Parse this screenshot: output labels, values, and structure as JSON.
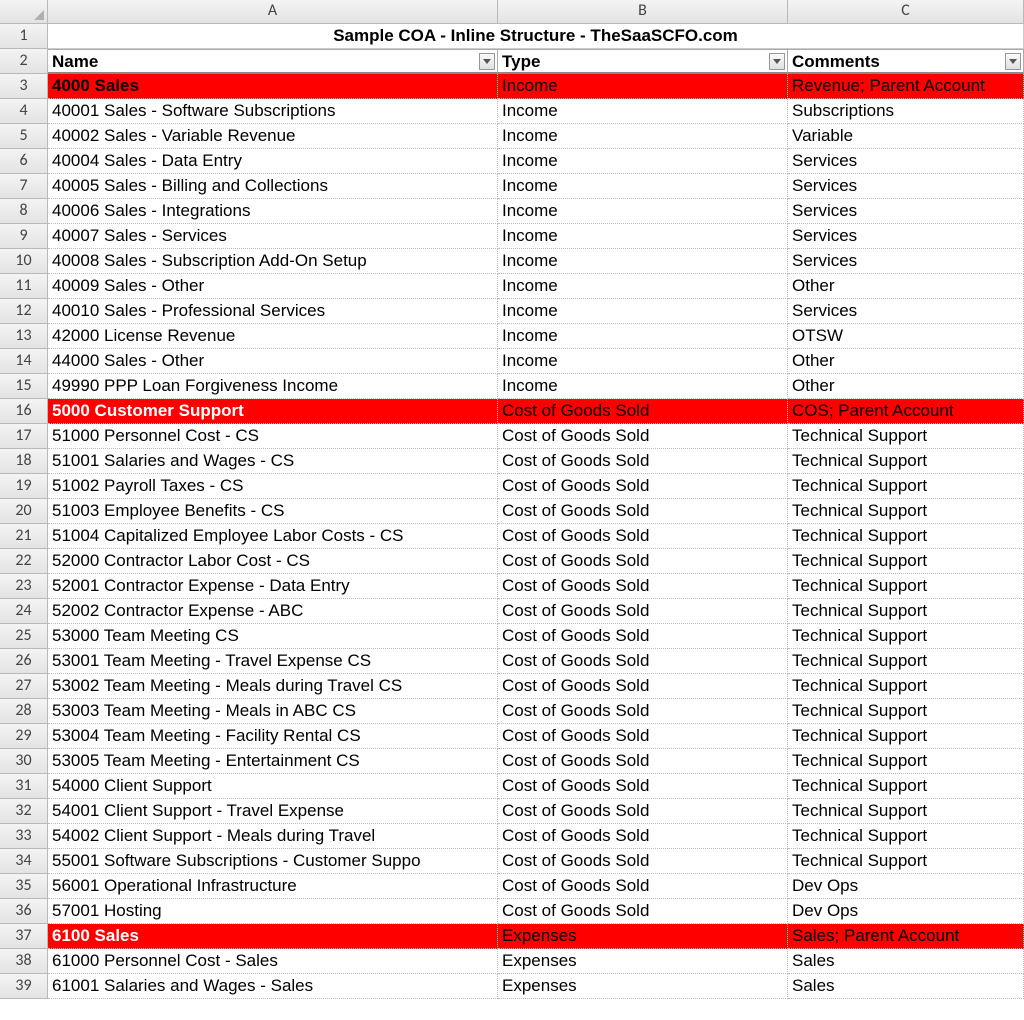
{
  "title": "Sample COA - Inline Structure - TheSaaSCFO.com",
  "columns": [
    "A",
    "B",
    "C"
  ],
  "headers": {
    "name": "Name",
    "type": "Type",
    "comments": "Comments"
  },
  "rows": [
    {
      "n": 3,
      "name": "4000 Sales",
      "type": "Income",
      "comments": "Revenue; Parent Account",
      "style": "parent-black"
    },
    {
      "n": 4,
      "name": "40001 Sales - Software Subscriptions",
      "type": "Income",
      "comments": "Subscriptions"
    },
    {
      "n": 5,
      "name": "40002 Sales - Variable Revenue",
      "type": "Income",
      "comments": "Variable"
    },
    {
      "n": 6,
      "name": "40004 Sales - Data Entry",
      "type": "Income",
      "comments": "Services"
    },
    {
      "n": 7,
      "name": "40005 Sales - Billing and Collections",
      "type": "Income",
      "comments": "Services"
    },
    {
      "n": 8,
      "name": "40006 Sales - Integrations",
      "type": "Income",
      "comments": "Services"
    },
    {
      "n": 9,
      "name": "40007 Sales - Services",
      "type": "Income",
      "comments": "Services"
    },
    {
      "n": 10,
      "name": "40008 Sales - Subscription Add-On Setup",
      "type": "Income",
      "comments": "Services"
    },
    {
      "n": 11,
      "name": "40009 Sales - Other",
      "type": "Income",
      "comments": "Other"
    },
    {
      "n": 12,
      "name": "40010 Sales - Professional Services",
      "type": "Income",
      "comments": "Services"
    },
    {
      "n": 13,
      "name": "42000 License Revenue",
      "type": "Income",
      "comments": "OTSW"
    },
    {
      "n": 14,
      "name": "44000 Sales - Other",
      "type": "Income",
      "comments": "Other"
    },
    {
      "n": 15,
      "name": "49990 PPP Loan Forgiveness Income",
      "type": "Income",
      "comments": "Other"
    },
    {
      "n": 16,
      "name": "5000 Customer Support",
      "type": "Cost of Goods Sold",
      "comments": "COS; Parent Account",
      "style": "parent-white"
    },
    {
      "n": 17,
      "name": "51000 Personnel Cost - CS",
      "type": "Cost of Goods Sold",
      "comments": "Technical Support"
    },
    {
      "n": 18,
      "name": "51001 Salaries and Wages - CS",
      "type": "Cost of Goods Sold",
      "comments": "Technical Support"
    },
    {
      "n": 19,
      "name": "51002 Payroll Taxes - CS",
      "type": "Cost of Goods Sold",
      "comments": "Technical Support"
    },
    {
      "n": 20,
      "name": "51003 Employee Benefits - CS",
      "type": "Cost of Goods Sold",
      "comments": "Technical Support"
    },
    {
      "n": 21,
      "name": "51004 Capitalized Employee Labor Costs - CS",
      "type": "Cost of Goods Sold",
      "comments": "Technical Support"
    },
    {
      "n": 22,
      "name": "52000 Contractor Labor Cost - CS",
      "type": "Cost of Goods Sold",
      "comments": "Technical Support"
    },
    {
      "n": 23,
      "name": "52001 Contractor Expense - Data Entry",
      "type": "Cost of Goods Sold",
      "comments": "Technical Support"
    },
    {
      "n": 24,
      "name": "52002 Contractor Expense - ABC",
      "type": "Cost of Goods Sold",
      "comments": "Technical Support"
    },
    {
      "n": 25,
      "name": "53000 Team Meeting CS",
      "type": "Cost of Goods Sold",
      "comments": "Technical Support"
    },
    {
      "n": 26,
      "name": "53001 Team Meeting - Travel Expense CS",
      "type": "Cost of Goods Sold",
      "comments": "Technical Support"
    },
    {
      "n": 27,
      "name": "53002 Team Meeting - Meals during Travel CS",
      "type": "Cost of Goods Sold",
      "comments": "Technical Support"
    },
    {
      "n": 28,
      "name": "53003 Team Meeting - Meals in ABC CS",
      "type": "Cost of Goods Sold",
      "comments": "Technical Support"
    },
    {
      "n": 29,
      "name": "53004 Team Meeting - Facility Rental CS",
      "type": "Cost of Goods Sold",
      "comments": "Technical Support"
    },
    {
      "n": 30,
      "name": "53005 Team Meeting - Entertainment CS",
      "type": "Cost of Goods Sold",
      "comments": "Technical Support"
    },
    {
      "n": 31,
      "name": "54000 Client Support",
      "type": "Cost of Goods Sold",
      "comments": "Technical Support"
    },
    {
      "n": 32,
      "name": "54001 Client Support - Travel Expense",
      "type": "Cost of Goods Sold",
      "comments": "Technical Support"
    },
    {
      "n": 33,
      "name": "54002 Client Support - Meals during Travel",
      "type": "Cost of Goods Sold",
      "comments": "Technical Support"
    },
    {
      "n": 34,
      "name": "55001 Software Subscriptions - Customer Suppo",
      "type": "Cost of Goods Sold",
      "comments": "Technical Support"
    },
    {
      "n": 35,
      "name": "56001 Operational Infrastructure",
      "type": "Cost of Goods Sold",
      "comments": "Dev Ops"
    },
    {
      "n": 36,
      "name": "57001 Hosting",
      "type": "Cost of Goods Sold",
      "comments": "Dev Ops"
    },
    {
      "n": 37,
      "name": "6100 Sales",
      "type": "Expenses",
      "comments": "Sales; Parent Account",
      "style": "parent-white"
    },
    {
      "n": 38,
      "name": "61000 Personnel Cost - Sales",
      "type": "Expenses",
      "comments": "Sales"
    },
    {
      "n": 39,
      "name": "61001 Salaries and Wages - Sales",
      "type": "Expenses",
      "comments": "Sales"
    }
  ]
}
